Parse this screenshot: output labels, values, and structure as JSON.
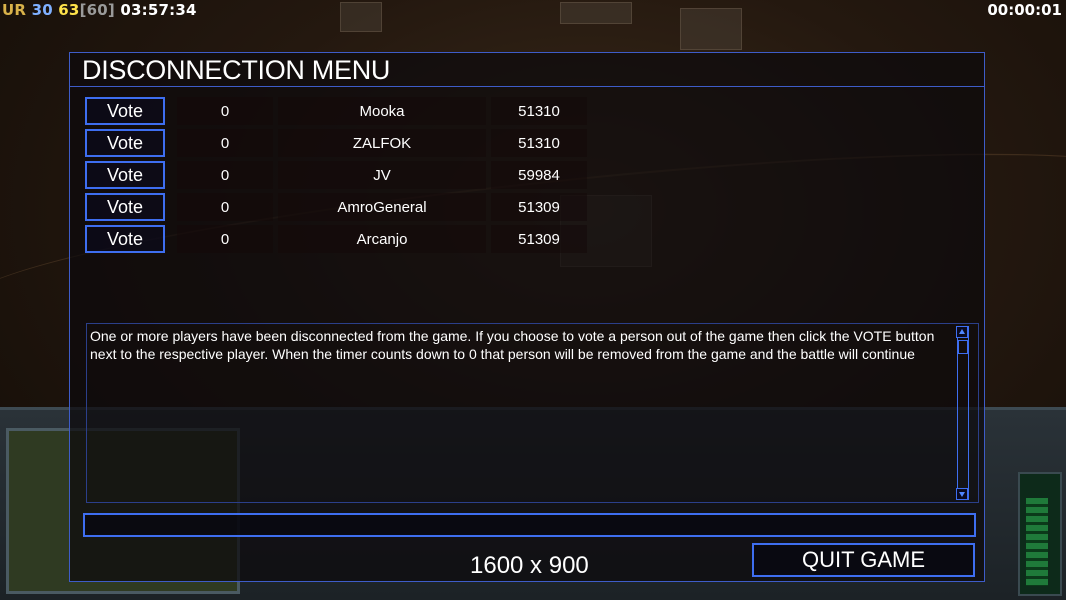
{
  "hud": {
    "ur_label": "UR",
    "fps_current": "30",
    "fps_avg": "63",
    "fps_cap": "[60]",
    "game_clock": "03:57:34",
    "disconnect_timer": "00:00:01"
  },
  "dialog": {
    "title": "DISCONNECTION MENU",
    "players": [
      {
        "vote_label": "Vote",
        "timer": "0",
        "name": "Mooka",
        "ping": "51310"
      },
      {
        "vote_label": "Vote",
        "timer": "0",
        "name": "ZALFOK",
        "ping": "51310"
      },
      {
        "vote_label": "Vote",
        "timer": "0",
        "name": "JV",
        "ping": "59984"
      },
      {
        "vote_label": "Vote",
        "timer": "0",
        "name": "AmroGeneral",
        "ping": "51309"
      },
      {
        "vote_label": "Vote",
        "timer": "0",
        "name": "Arcanjo",
        "ping": "51309"
      }
    ],
    "message": "One or more players have been disconnected from the game. If you choose to vote a person out of the game then click the VOTE  button next to the respective player. When the timer counts down to 0 that person will be removed from the game and the battle will continue",
    "chat_value": "",
    "quit_label": "QUIT GAME"
  },
  "resolution_label": "1600 x 900",
  "colors": {
    "accent": "#3e6ef0",
    "fps_current": "#7fb0ff",
    "fps_avg": "#ffe34a",
    "ur": "#d9b24a"
  }
}
